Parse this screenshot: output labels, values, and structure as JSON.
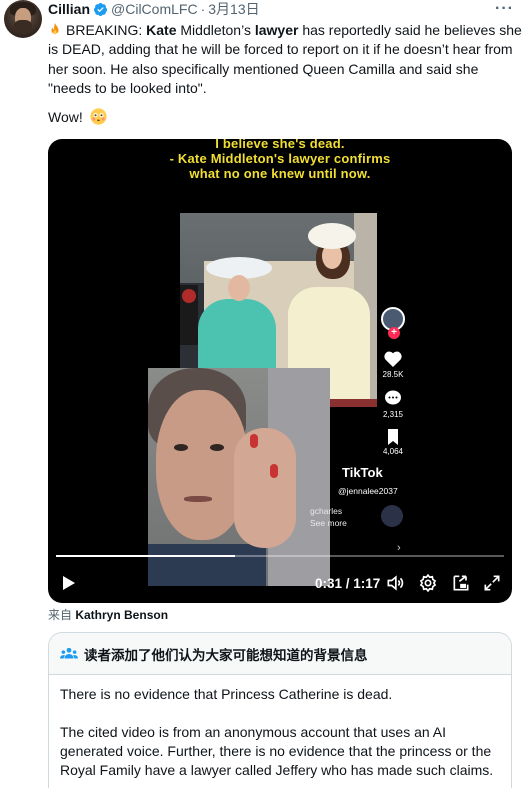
{
  "user": {
    "display_name": "Cillian",
    "handle": "@CilComLFC",
    "separator": "·",
    "date": "3月13日",
    "verified_color": "#1d9bf0"
  },
  "tweet": {
    "prefix": "BREAKING: ",
    "name_bold": "Kate",
    "mid1": " Middleton’s ",
    "lawyer_bold": "lawyer",
    "rest": " has reportedly said he believes she is DEAD, adding that he will be forced to report on it if he doesn’t hear from her soon. He also specifically mentioned Queen Camilla and said she \"needs to be looked into\".",
    "wow": "Wow!"
  },
  "video": {
    "caption_lines": [
      "I believe she's dead.",
      "- Kate Middleton's lawyer confirms",
      "what no one knew until now."
    ],
    "side_counts": [
      "28.5K",
      "2,315",
      "4,064"
    ],
    "tiktok_logo": "TikTok",
    "tiktok_user": "@jennalee2037",
    "tiktok_sub1": "gcharles",
    "tiktok_sub2": "See more",
    "current_time": "0:31",
    "time_sep": " / ",
    "duration": "1:17",
    "progress": 0.4
  },
  "source": {
    "prefix": "来自 ",
    "name": "Kathryn Benson"
  },
  "community_note": {
    "title": "读者添加了他们认为大家可能想知道的背景信息",
    "paragraphs": [
      "There is no evidence that Princess Catherine is dead.",
      "The cited video is from an anonymous account that uses an AI generated voice. Further, there is no evidence that the princess or the Royal Family have a lawyer called Jeffery who has made such claims."
    ]
  }
}
